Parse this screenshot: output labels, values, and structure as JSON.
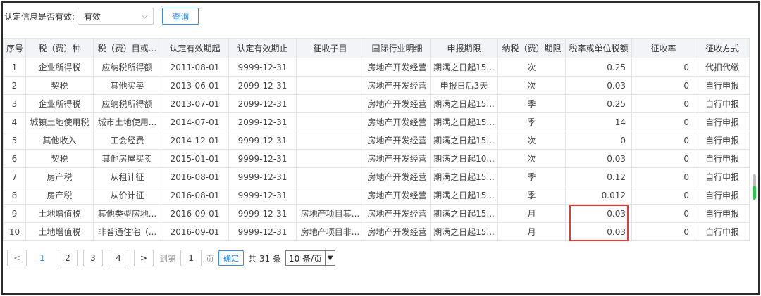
{
  "filter": {
    "label": "认定信息是否有效:",
    "value": "有效",
    "query_label": "查询"
  },
  "table": {
    "headers": [
      "序号",
      "税（费）种",
      "税（费）目或...",
      "认定有效期起",
      "认定有效期止",
      "征收子目",
      "国际行业明细",
      "申报期限",
      "纳税（费）期限",
      "税率或单位税额",
      "征收率",
      "征收方式"
    ],
    "rows": [
      [
        "1",
        "企业所得税",
        "应纳税所得额",
        "2011-08-01",
        "9999-12-31",
        "",
        "房地产开发经营",
        "期满之日起15...",
        "次",
        "0.25",
        "0",
        "代扣代缴"
      ],
      [
        "2",
        "契税",
        "其他买卖",
        "2013-06-01",
        "2099-12-31",
        "",
        "房地产开发经营",
        "申报日后3天",
        "次",
        "0.03",
        "0",
        "自行申报"
      ],
      [
        "3",
        "企业所得税",
        "应纳税所得额",
        "2013-07-01",
        "2099-12-31",
        "",
        "房地产开发经营",
        "期满之日起15...",
        "季",
        "0.25",
        "0",
        "自行申报"
      ],
      [
        "4",
        "城镇土地使用税",
        "城市土地使用...",
        "2014-07-01",
        "2099-12-31",
        "",
        "房地产开发经营",
        "期满之日起15...",
        "季",
        "14",
        "0",
        "自行申报"
      ],
      [
        "5",
        "其他收入",
        "工会经费",
        "2014-12-01",
        "9999-12-31",
        "",
        "房地产开发经营",
        "期满之日起15...",
        "次",
        "0",
        "0",
        "自行申报"
      ],
      [
        "6",
        "契税",
        "其他房屋买卖",
        "2015-01-01",
        "9999-12-31",
        "",
        "房地产开发经营",
        "期满之日起10...",
        "次",
        "0.03",
        "0",
        "自行申报"
      ],
      [
        "7",
        "房产税",
        "从租计征",
        "2016-08-01",
        "9999-12-31",
        "",
        "房地产开发经营",
        "期满之日起15...",
        "季",
        "0.12",
        "0",
        "自行申报"
      ],
      [
        "8",
        "房产税",
        "从价计征",
        "2016-08-01",
        "9999-12-31",
        "",
        "房地产开发经营",
        "期满之日起15...",
        "季",
        "0.012",
        "0",
        "自行申报"
      ],
      [
        "9",
        "土地增值税",
        "其他类型房地...",
        "2016-09-01",
        "9999-12-31",
        "房地产项目其...",
        "房地产开发经营",
        "期满之日起15...",
        "月",
        "0.03",
        "0",
        "自行申报"
      ],
      [
        "10",
        "土地增值税",
        "非普通住宅（...",
        "2016-09-01",
        "9999-12-31",
        "房地产项目非...",
        "房地产开发经营",
        "期满之日起15...",
        "月",
        "0.03",
        "0",
        "自行申报"
      ]
    ]
  },
  "pager": {
    "prev": "<",
    "pages": [
      "1",
      "2",
      "3",
      "4"
    ],
    "current": "1",
    "next": ">",
    "goto_label": "到第",
    "goto_value": "1",
    "page_unit": "页",
    "confirm": "确定",
    "total": "共 31 条",
    "page_size": "10 条/页"
  },
  "colors": {
    "accent": "#2d8cf0",
    "highlight": "#e53935",
    "scroll_green": "#33c24d"
  }
}
